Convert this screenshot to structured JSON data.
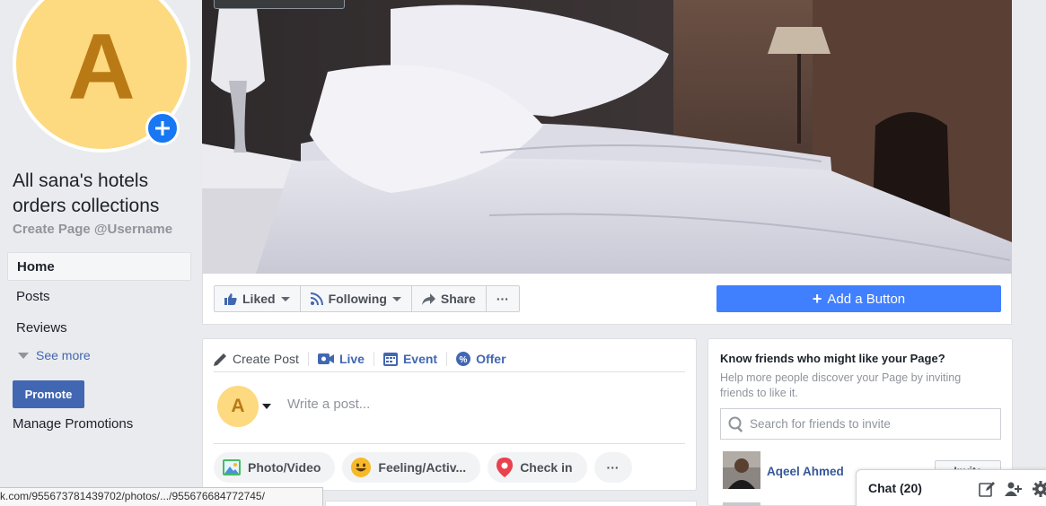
{
  "page": {
    "avatar_letter": "A",
    "name": "All sana's hotels orders collections",
    "username": "Create Page @Username"
  },
  "left_nav": {
    "items": [
      {
        "label": "Home",
        "active": true
      },
      {
        "label": "Posts"
      },
      {
        "label": "Reviews"
      }
    ],
    "see_more": "See more",
    "promote": "Promote",
    "manage_promotions": "Manage Promotions"
  },
  "action_bar": {
    "liked": "Liked",
    "following": "Following",
    "share": "Share",
    "more": "···",
    "add_button": "Add a Button"
  },
  "composer": {
    "tabs": [
      "Create Post",
      "Live",
      "Event",
      "Offer"
    ],
    "avatar_letter": "A",
    "placeholder": "Write a post...",
    "actions": [
      "Photo/Video",
      "Feeling/Activ...",
      "Check in"
    ],
    "more": "···"
  },
  "invite": {
    "title": "Know friends who might like your Page?",
    "description": "Help more people discover your Page by inviting friends to like it.",
    "search_placeholder": "Search for friends to invite",
    "friend_name": "Aqeel Ahmed",
    "invite_label": "Invite"
  },
  "chat": {
    "label": "Chat (20)"
  },
  "status_bar": {
    "url": "k.com/955673781439702/photos/.../955676684772745/"
  },
  "colors": {
    "brand_blue": "#4267b2",
    "add_button_blue": "#4080ff",
    "avatar_bg": "#fdd97f",
    "avatar_letter": "#b97a16"
  }
}
